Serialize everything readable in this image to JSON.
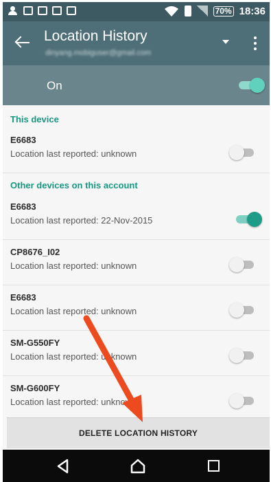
{
  "status_bar": {
    "icons": [
      "person-icon",
      "chat-icon",
      "image-icon",
      "gmail-icon",
      "calendar-icon"
    ],
    "right_icons": [
      "wifi-icon",
      "battery-saver-icon",
      "signal-icon"
    ],
    "battery": "70%",
    "time": "18:36"
  },
  "app_bar": {
    "title": "Location History",
    "account": "dinyang.mobiguser@gmail.com"
  },
  "master": {
    "label": "On",
    "enabled": true
  },
  "sections": {
    "this_device": "This device",
    "other_devices": "Other devices on this account"
  },
  "devices": [
    {
      "name": "E6683",
      "status": "Location last reported: unknown",
      "enabled": false
    },
    {
      "name": "E6683",
      "status": "Location last reported: 22-Nov-2015",
      "enabled": true
    },
    {
      "name": "CP8676_I02",
      "status": "Location last reported: unknown",
      "enabled": false
    },
    {
      "name": "E6683",
      "status": "Location last reported: unknown",
      "enabled": false
    },
    {
      "name": "SM-G550FY",
      "status": "Location last reported: unknown",
      "enabled": false
    },
    {
      "name": "SM-G600FY",
      "status": "Location last reported: unknown",
      "enabled": false
    }
  ],
  "delete_button": "DELETE LOCATION HISTORY",
  "colors": {
    "accent": "#1f9c87",
    "app_bar": "#4f6f78",
    "arrow": "#ec4b1f"
  }
}
